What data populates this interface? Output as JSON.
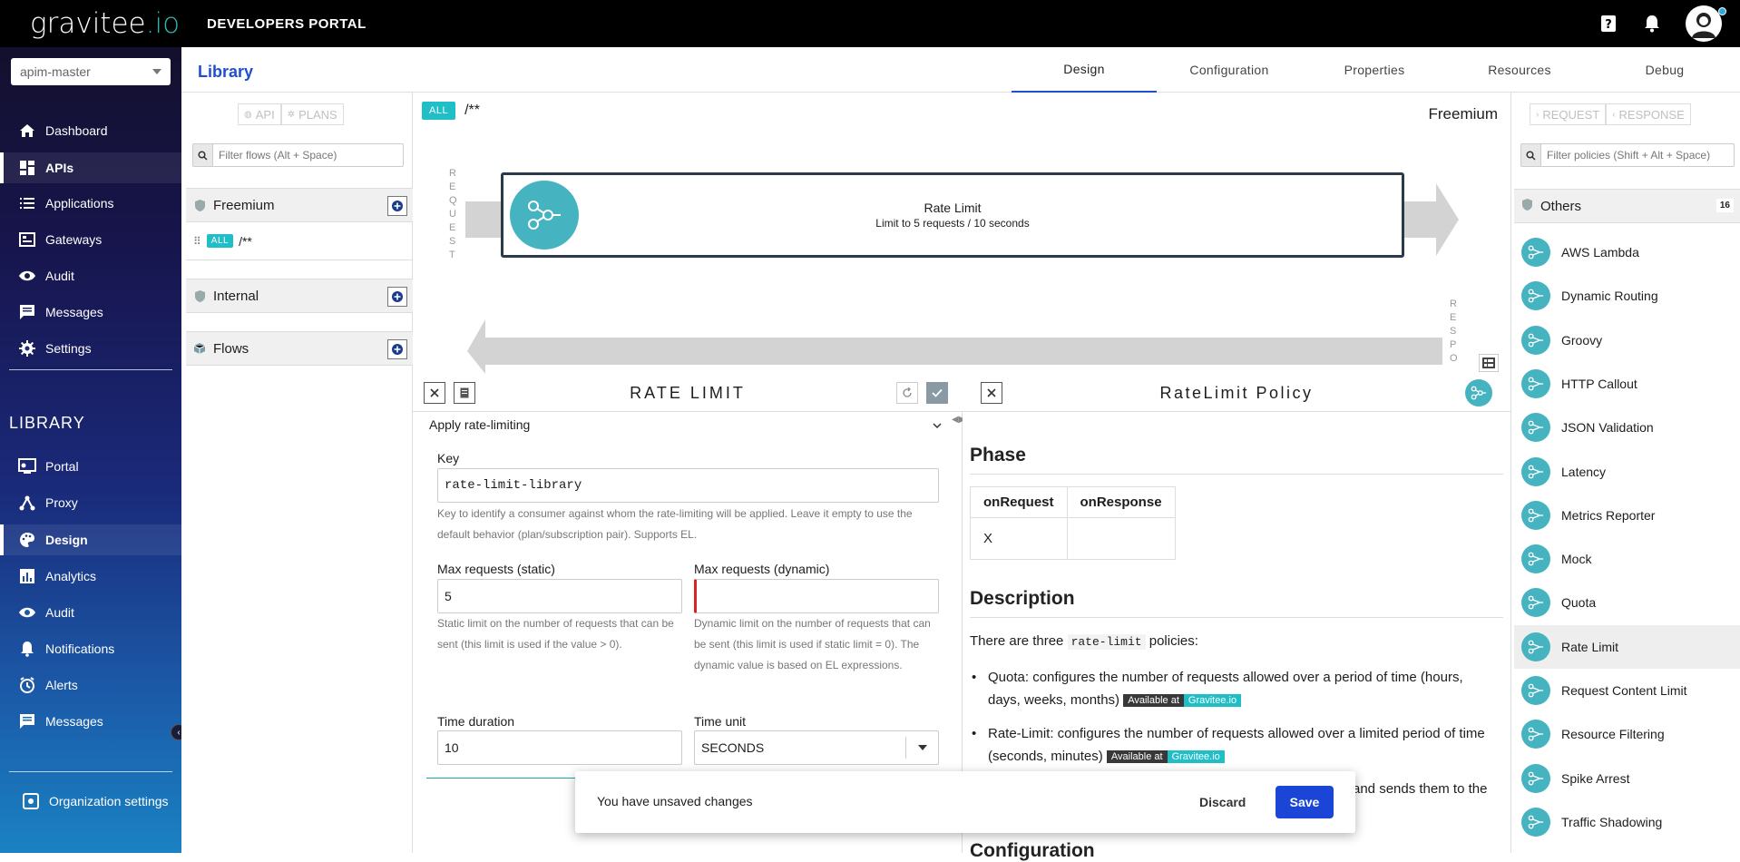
{
  "topbar": {
    "logo_main": "gravitee",
    "logo_io": ".io",
    "portal_title": "DEVELOPERS PORTAL",
    "icons": [
      "help-icon",
      "bell-icon",
      "user-avatar"
    ]
  },
  "sidebar": {
    "environment": "apim-master",
    "main_items": [
      {
        "label": "Dashboard",
        "icon": "home-icon"
      },
      {
        "label": "APIs",
        "icon": "apis-icon",
        "active": true
      },
      {
        "label": "Applications",
        "icon": "list-icon"
      },
      {
        "label": "Gateways",
        "icon": "gateway-icon"
      },
      {
        "label": "Audit",
        "icon": "eye-icon"
      },
      {
        "label": "Messages",
        "icon": "message-icon"
      },
      {
        "label": "Settings",
        "icon": "gear-icon"
      }
    ],
    "library_title": "LIBRARY",
    "library_items": [
      {
        "label": "Portal",
        "icon": "portal-icon"
      },
      {
        "label": "Proxy",
        "icon": "proxy-icon"
      },
      {
        "label": "Design",
        "icon": "palette-icon",
        "active": true
      },
      {
        "label": "Analytics",
        "icon": "chart-icon"
      },
      {
        "label": "Audit",
        "icon": "eye-icon"
      },
      {
        "label": "Notifications",
        "icon": "bell-icon"
      },
      {
        "label": "Alerts",
        "icon": "alarm-icon"
      },
      {
        "label": "Messages",
        "icon": "message-icon"
      }
    ],
    "org_settings": "Organization settings"
  },
  "header": {
    "title": "Library",
    "tabs": [
      {
        "label": "Design",
        "active": true
      },
      {
        "label": "Configuration"
      },
      {
        "label": "Properties"
      },
      {
        "label": "Resources"
      },
      {
        "label": "Debug"
      }
    ]
  },
  "flows_panel": {
    "toggle_api": "API",
    "toggle_plans": "PLANS",
    "filter_placeholder": "Filter flows (Alt + Space)",
    "groups": {
      "freemium": "Freemium",
      "flow_badge": "ALL",
      "flow_path": "/**",
      "internal": "Internal",
      "flows": "Flows"
    }
  },
  "canvas": {
    "badge": "ALL",
    "path": "/**",
    "plan": "Freemium",
    "request_label": "REQUEST",
    "response_label": "RESPO",
    "policy_name": "Rate Limit",
    "policy_desc": "Limit to 5 requests / 10 seconds"
  },
  "policies_panel": {
    "toggle_request": "REQUEST",
    "toggle_response": "RESPONSE",
    "filter_placeholder": "Filter policies (Shift + Alt + Space)",
    "group": "Others",
    "count": "16",
    "items": [
      "AWS Lambda",
      "Dynamic Routing",
      "Groovy",
      "HTTP Callout",
      "JSON Validation",
      "Latency",
      "Metrics Reporter",
      "Mock",
      "Quota",
      "Rate Limit",
      "Request Content Limit",
      "Resource Filtering",
      "Spike Arrest",
      "Traffic Shadowing"
    ],
    "active_item": "Rate Limit"
  },
  "form": {
    "title": "RATE LIMIT",
    "section": "Apply rate-limiting",
    "key_label": "Key",
    "key_value": "rate-limit-library",
    "key_hint": "Key to identify a consumer against whom the rate-limiting will be applied. Leave it empty to use the default behavior (plan/subscription pair). Supports EL.",
    "max_static_label": "Max requests (static)",
    "max_static_value": "5",
    "max_static_hint": "Static limit on the number of requests that can be sent (this limit is used if the value > 0).",
    "max_dynamic_label": "Max requests (dynamic)",
    "max_dynamic_value": "",
    "max_dynamic_hint": "Dynamic limit on the number of requests that can be sent (this limit is used if static limit = 0). The dynamic value is based on EL expressions.",
    "duration_label": "Time duration",
    "duration_value": "10",
    "unit_label": "Time unit",
    "unit_value": "SECONDS"
  },
  "doc": {
    "title": "RateLimit Policy",
    "phase_heading": "Phase",
    "phase_cols": [
      "onRequest",
      "onResponse"
    ],
    "phase_row": [
      "X",
      ""
    ],
    "description_heading": "Description",
    "intro_pre": "There are three",
    "intro_code": "rate-limit",
    "intro_post": "policies:",
    "bullet1": "Quota: configures the number of requests allowed over a period of time (hours, days, weeks, months)",
    "bullet2": "Rate-Limit: configures the number of requests allowed over a limited period of time (seconds, minutes)",
    "available_at": "Available at",
    "gravitee": "Gravitee.io",
    "partial_text": "and sends them to the",
    "configuration_heading": "Configuration"
  },
  "snackbar": {
    "message": "You have unsaved changes",
    "discard": "Discard",
    "save": "Save"
  }
}
